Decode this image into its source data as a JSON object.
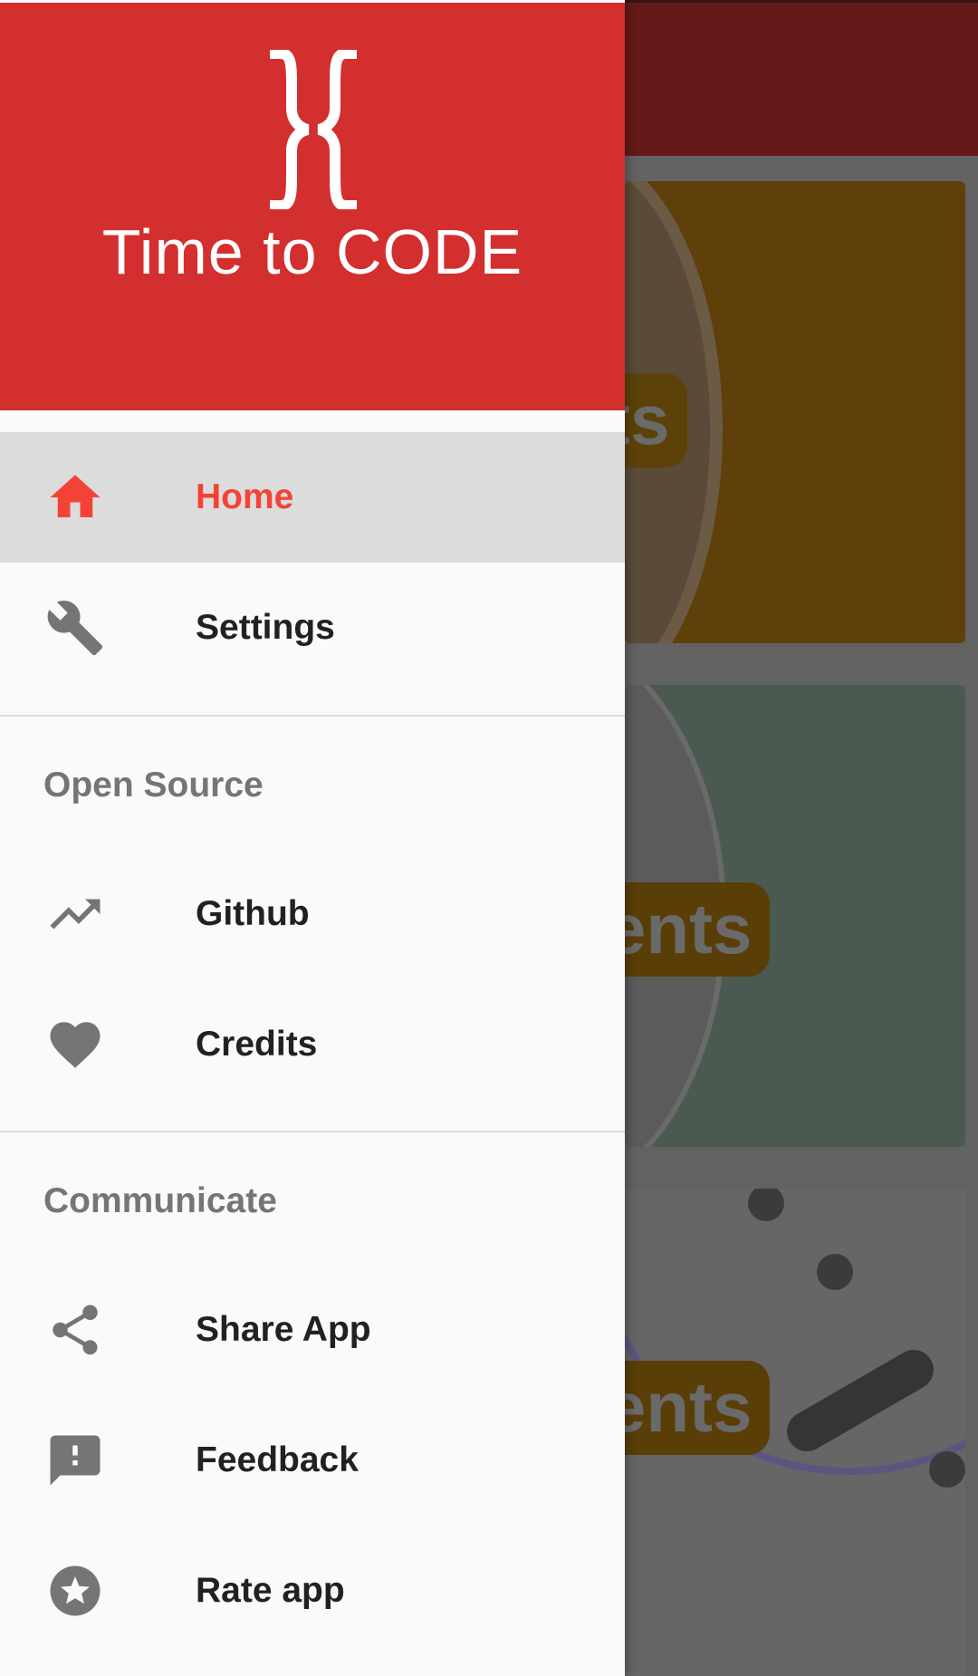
{
  "app": {
    "logo_text": "Time to CODE"
  },
  "background": {
    "cards": [
      {
        "label_fragment": "ts"
      },
      {
        "label_fragment": "ents"
      },
      {
        "label_fragment": "ents"
      }
    ]
  },
  "drawer": {
    "primary": [
      {
        "label": "Home",
        "icon": "home-icon",
        "active": true
      },
      {
        "label": "Settings",
        "icon": "wrench-icon",
        "active": false
      }
    ],
    "sections": [
      {
        "title": "Open Source",
        "items": [
          {
            "label": "Github",
            "icon": "trending-up-icon"
          },
          {
            "label": "Credits",
            "icon": "heart-icon"
          }
        ]
      },
      {
        "title": "Communicate",
        "items": [
          {
            "label": "Share App",
            "icon": "share-icon"
          },
          {
            "label": "Feedback",
            "icon": "feedback-icon"
          },
          {
            "label": "Rate app",
            "icon": "star-circle-icon"
          }
        ]
      }
    ]
  },
  "colors": {
    "primary": "#d32f2f",
    "accent": "#f44336",
    "active_bg": "#dcdcdc",
    "icon_gray": "#757575"
  }
}
